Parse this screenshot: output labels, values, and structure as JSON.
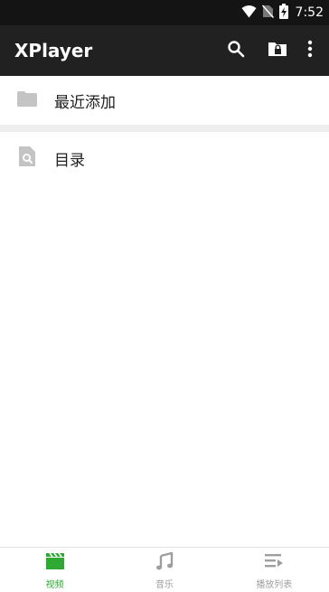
{
  "status_bar": {
    "time": "7:52",
    "icons": [
      "wifi-icon",
      "no-sim-icon",
      "battery-charging-icon"
    ]
  },
  "app_bar": {
    "title": "XPlayer",
    "actions": [
      "search-icon",
      "private-folder-lock-icon",
      "more-vert-icon"
    ]
  },
  "list": {
    "items": [
      {
        "label": "最近添加",
        "icon": "folder-icon"
      },
      {
        "label": "目录",
        "icon": "file-search-icon"
      }
    ]
  },
  "bottom_nav": {
    "items": [
      {
        "label": "视频",
        "icon": "video-clapper-icon",
        "active": true
      },
      {
        "label": "音乐",
        "icon": "music-note-icon",
        "active": false
      },
      {
        "label": "播放列表",
        "icon": "playlist-play-icon",
        "active": false
      }
    ]
  },
  "colors": {
    "status_bar_bg": "#141414",
    "app_bar_bg": "#212121",
    "accent": "#2eaa32",
    "inactive": "#9e9e9e",
    "icon_grey": "#c4c4c4",
    "divider": "#eeeeee"
  }
}
